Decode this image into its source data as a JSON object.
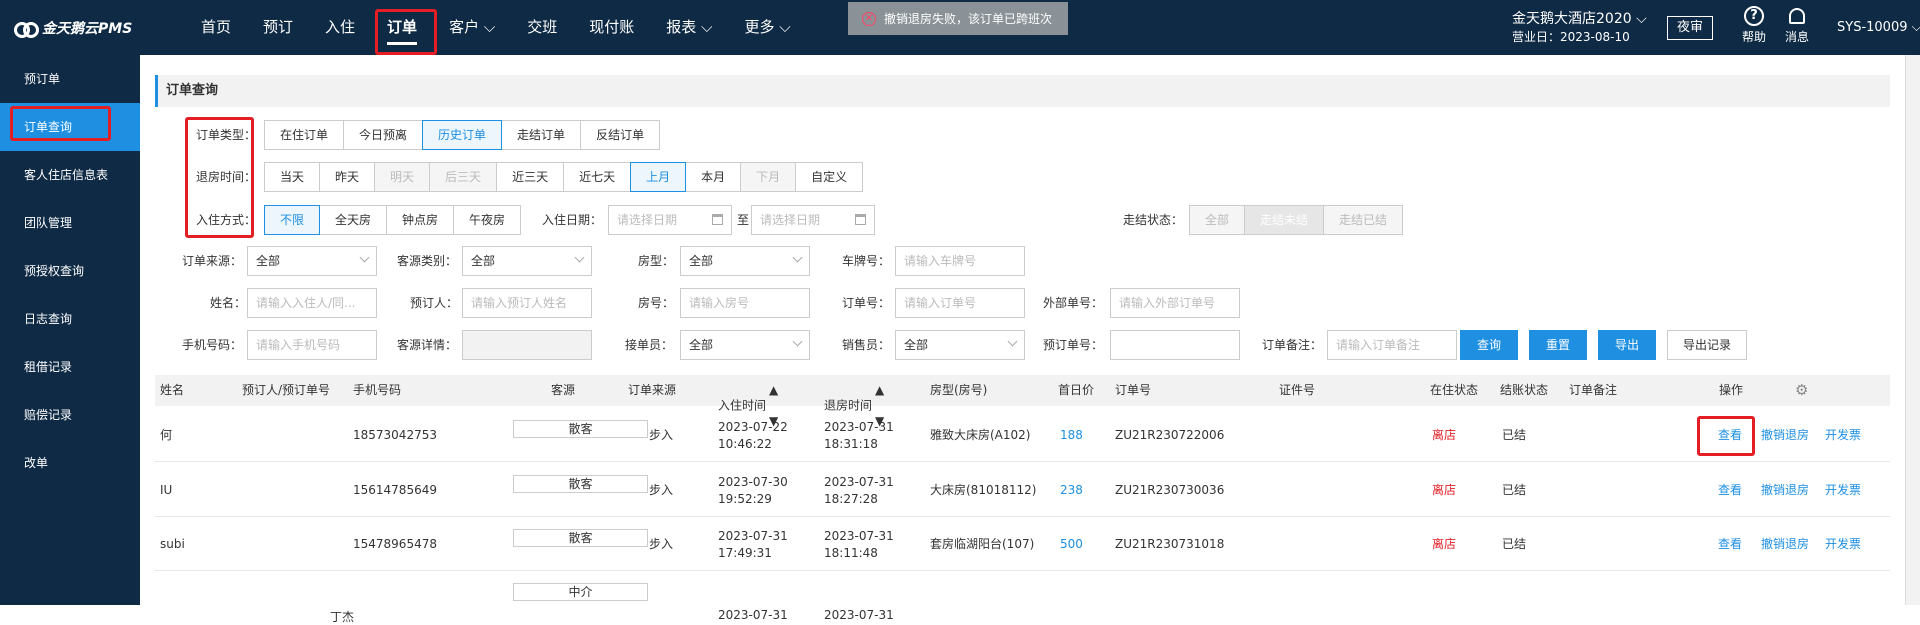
{
  "app": {
    "logo_text": "金天鹅云PMS"
  },
  "nav": {
    "items": [
      "首页",
      "预订",
      "入住",
      "订单",
      "客户",
      "交班",
      "现付账",
      "报表",
      "更多"
    ],
    "active": "订单"
  },
  "toast": {
    "text": "撤销退房失败，该订单已跨班次"
  },
  "header": {
    "hotel": "金天鹅大酒店2020",
    "business_date": "营业日：2023-08-10",
    "night_audit": "夜审",
    "help": "帮助",
    "messages": "消息",
    "user": "SYS-10009"
  },
  "sidebar": {
    "items": [
      "预订单",
      "订单查询",
      "客人住店信息表",
      "团队管理",
      "预授权查询",
      "日志查询",
      "租借记录",
      "赔偿记录",
      "改单"
    ],
    "active": "订单查询"
  },
  "page": {
    "title": "订单查询"
  },
  "filters": {
    "order_type_label": "订单类型：",
    "order_type": [
      "在住订单",
      "今日预离",
      "历史订单",
      "走结订单",
      "反结订单"
    ],
    "checkout_time_label": "退房时间：",
    "checkout_time": [
      "当天",
      "昨天",
      "明天",
      "后三天",
      "近三天",
      "近七天",
      "上月",
      "本月",
      "下月",
      "自定义"
    ],
    "checkin_mode_label": "入住方式：",
    "checkin_mode": [
      "不限",
      "全天房",
      "钟点房",
      "午夜房"
    ],
    "checkin_date_label": "入住日期：",
    "date_placeholder": "请选择日期",
    "date_sep": "至",
    "settle_label": "走结状态：",
    "settle": [
      "全部",
      "走结未结",
      "走结已结"
    ],
    "source_label": "订单来源：",
    "source_value": "全部",
    "guest_type_label": "客源类别：",
    "guest_type_value": "全部",
    "room_type_label": "房型：",
    "room_type_value": "全部",
    "plate_label": "车牌号：",
    "plate_placeholder": "请输入车牌号",
    "name_label": "姓名：",
    "name_placeholder": "请输入入住人/同...",
    "booker_label": "预订人：",
    "booker_placeholder": "请输入预订人姓名",
    "room_no_label": "房号：",
    "room_no_placeholder": "请输入房号",
    "order_no_label": "订单号：",
    "order_no_placeholder": "请输入订单号",
    "ext_no_label": "外部单号：",
    "ext_no_placeholder": "请输入外部订单号",
    "phone_label": "手机号码：",
    "phone_placeholder": "请输入手机号码",
    "guest_detail_label": "客源详情：",
    "receiver_label": "接单员：",
    "receiver_value": "全部",
    "seller_label": "销售员：",
    "seller_value": "全部",
    "booking_no_label": "预订单号：",
    "remark_label": "订单备注：",
    "remark_placeholder": "请输入订单备注",
    "buttons": {
      "query": "查询",
      "reset": "重置",
      "export": "导出",
      "export_log": "导出记录"
    }
  },
  "table": {
    "headers": [
      "姓名",
      "预订人/预订单号",
      "手机号码",
      "客源",
      "订单来源",
      "入住时间",
      "退房时间",
      "房型(房号)",
      "首日价",
      "订单号",
      "证件号",
      "在住状态",
      "结账状态",
      "订单备注",
      "操作"
    ],
    "rows": [
      {
        "name": "何",
        "booker": "",
        "phone": "18573042753",
        "source": "散客",
        "channel": "步入",
        "in_date": "2023-07-22",
        "in_time": "10:46:22",
        "out_date": "2023-07-31",
        "out_time": "18:31:18",
        "room": "雅致大床房(A102)",
        "price": "188",
        "order_no": "ZU21R230722006",
        "stay": "离店",
        "bill": "已结"
      },
      {
        "name": "IU",
        "booker": "",
        "phone": "15614785649",
        "source": "散客",
        "channel": "步入",
        "in_date": "2023-07-30",
        "in_time": "19:52:29",
        "out_date": "2023-07-31",
        "out_time": "18:27:28",
        "room": "大床房(81018112)",
        "price": "238",
        "order_no": "ZU21R230730036",
        "stay": "离店",
        "bill": "已结"
      },
      {
        "name": "subi",
        "booker": "",
        "phone": "15478965478",
        "source": "散客",
        "channel": "步入",
        "in_date": "2023-07-31",
        "in_time": "17:49:31",
        "out_date": "2023-07-31",
        "out_time": "18:11:48",
        "room": "套房临湖阳台(107)",
        "price": "500",
        "order_no": "ZU21R230731018",
        "stay": "离店",
        "bill": "已结"
      },
      {
        "name": "",
        "booker": "丁杰",
        "phone": "",
        "source": "中介",
        "channel": "",
        "in_date": "2023-07-31",
        "in_time": "",
        "out_date": "2023-07-31",
        "out_time": "",
        "room": "",
        "price": "",
        "order_no": "",
        "stay": "",
        "bill": ""
      }
    ],
    "actions": [
      "查看",
      "撤销退房",
      "开发票"
    ]
  }
}
